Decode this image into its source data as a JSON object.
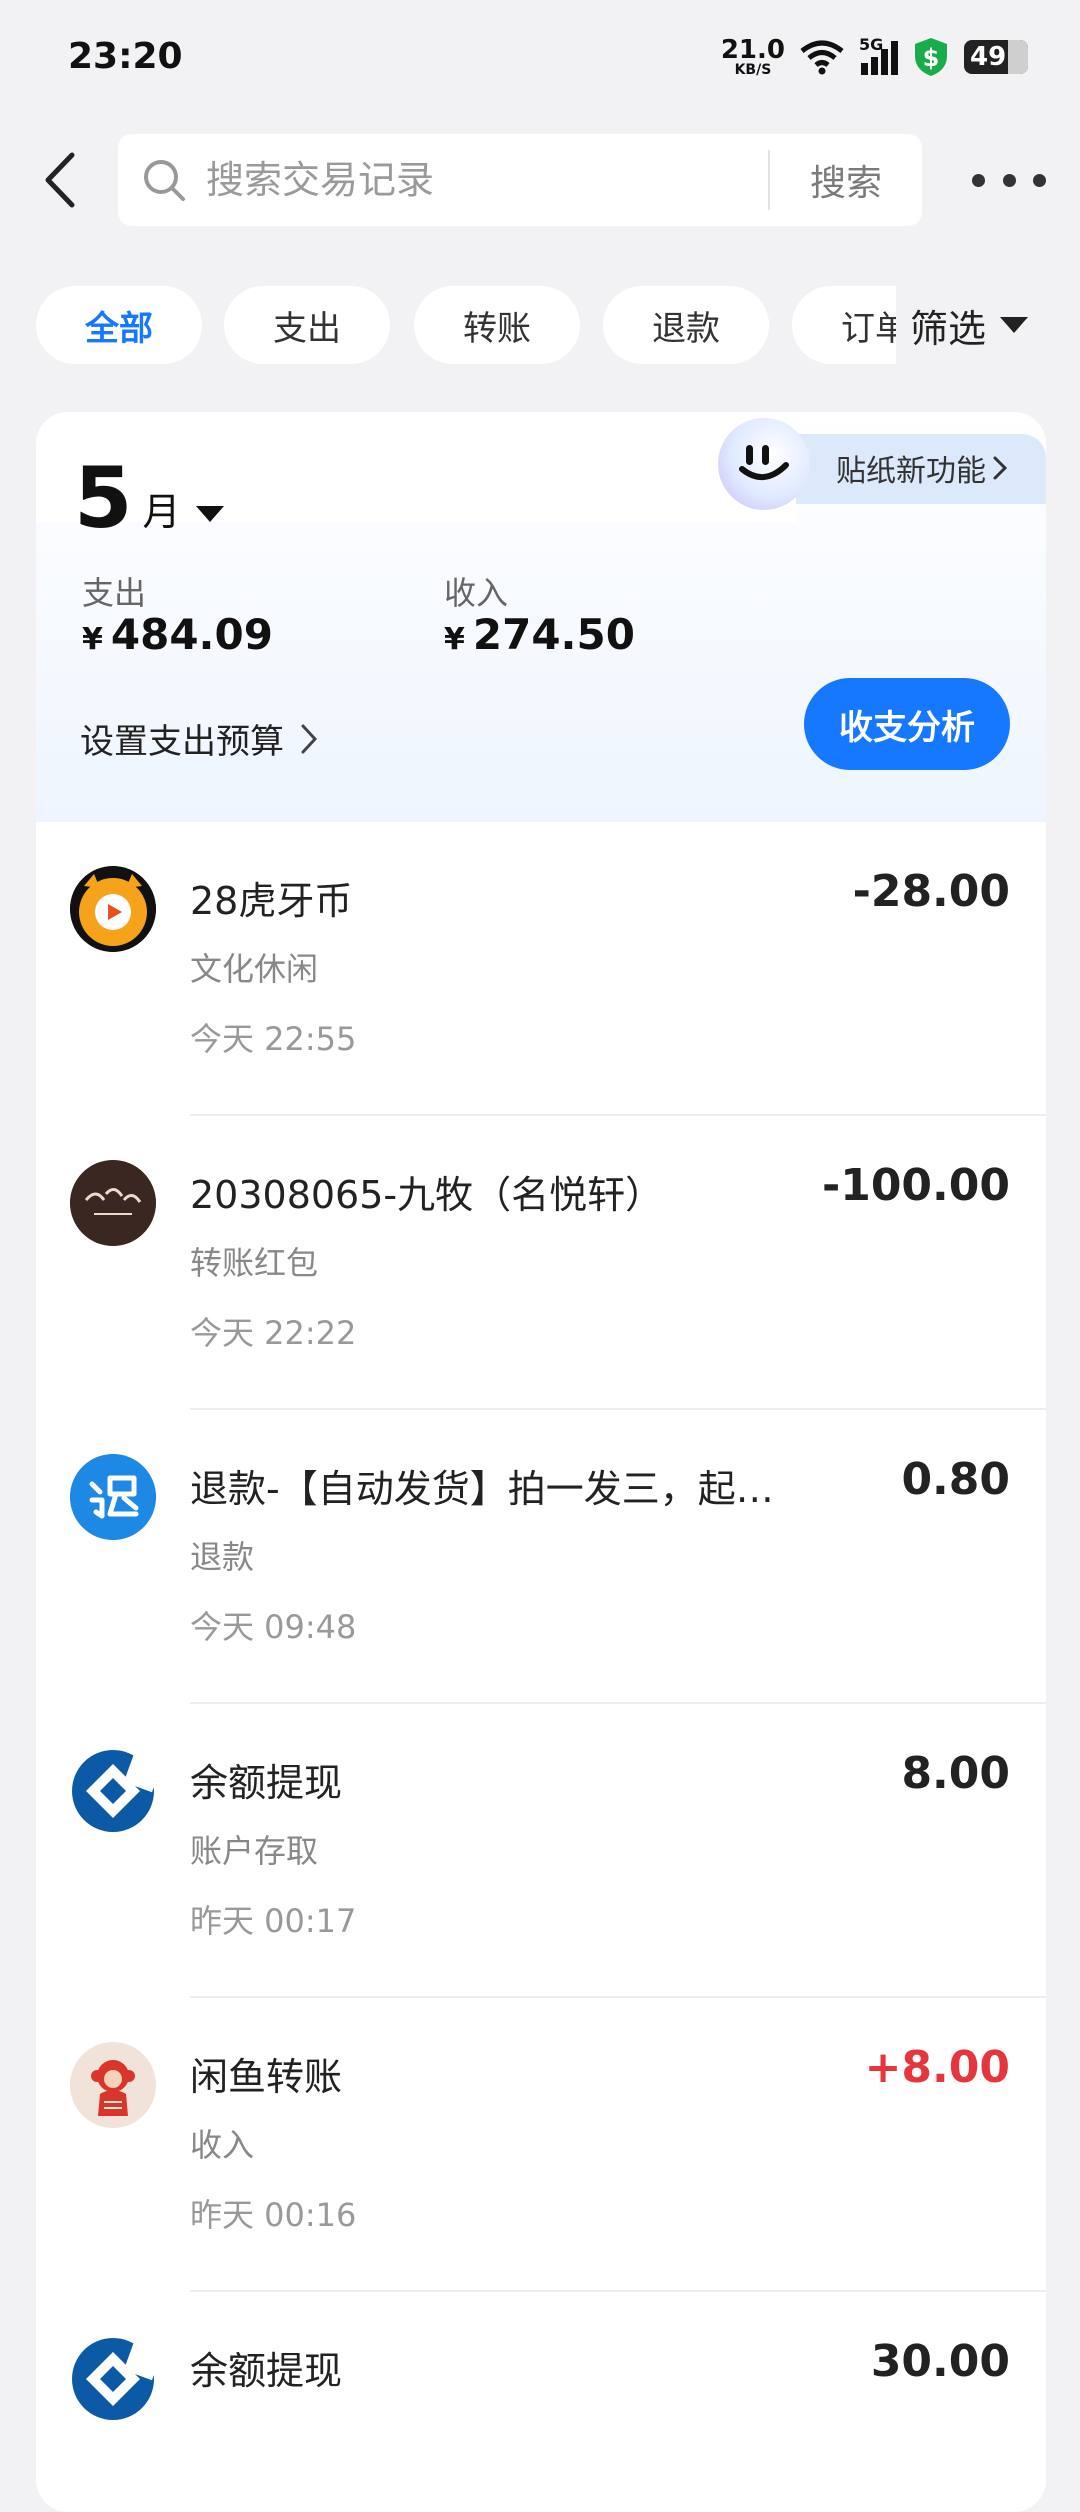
{
  "status_bar": {
    "time": "23:20",
    "net_speed_value": "21.0",
    "net_speed_unit": "KB/S",
    "network_label": "5G",
    "battery_level": "49"
  },
  "header": {
    "search_placeholder": "搜索交易记录",
    "search_button": "搜索"
  },
  "filters": {
    "chips": [
      "全部",
      "支出",
      "转账",
      "退款",
      "订单"
    ],
    "active_index": 0,
    "screen_label": "筛选"
  },
  "summary": {
    "month_number": "5",
    "month_unit": "月",
    "sticker_label": "贴纸新功能",
    "expense_label": "支出",
    "expense_value": "484.09",
    "income_label": "收入",
    "income_value": "274.50",
    "currency_symbol": "¥",
    "budget_label": "设置支出预算",
    "analysis_button": "收支分析"
  },
  "transactions": [
    {
      "title": "28虎牙币",
      "category": "文化休闲",
      "time": "今天 22:55",
      "amount": "-28.00",
      "icon": "huya-tiger-icon",
      "type": "expense"
    },
    {
      "title": "20308065-九牧（名悦轩）",
      "category": "转账红包",
      "time": "今天 22:22",
      "amount": "-100.00",
      "icon": "mingyuexuan-logo-icon",
      "type": "expense"
    },
    {
      "title": "退款-【自动发货】拍一发三，起点读书...",
      "category": "退款",
      "time": "今天 09:48",
      "amount": "0.80",
      "icon": "refund-icon",
      "type": "neutral"
    },
    {
      "title": "余额提现",
      "category": "账户存取",
      "time": "昨天 00:17",
      "amount": "8.00",
      "icon": "ccb-bank-icon",
      "type": "neutral"
    },
    {
      "title": "闲鱼转账",
      "category": "收入",
      "time": "昨天 00:16",
      "amount": "+8.00",
      "icon": "monkey-avatar-icon",
      "type": "income"
    },
    {
      "title": "余额提现",
      "category": "",
      "time": "",
      "amount": "30.00",
      "icon": "ccb-bank-icon",
      "type": "neutral"
    }
  ],
  "colors": {
    "accent": "#1677ff",
    "income": "#e5363d",
    "background": "#f2f2f4"
  }
}
